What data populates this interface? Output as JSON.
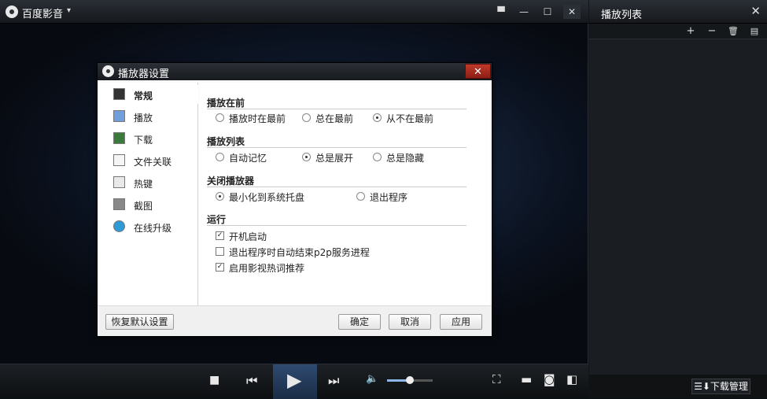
{
  "app": {
    "title": "百度影音",
    "title_arrow": "▾",
    "buttons": {
      "message": "▀",
      "minimize": "—",
      "maximize": "☐",
      "close": "✕"
    }
  },
  "playlist": {
    "title": "播放列表",
    "close": "✕",
    "tools": [
      "+",
      "−",
      "🗑",
      "▤"
    ],
    "download_manager": "☰⬇下载管理"
  },
  "controls": {
    "stop": "■",
    "prev": "⏮",
    "play": "▶",
    "next": "⏭",
    "volume": "🔈",
    "volume_level": 0.5,
    "fullscreen": "⛶",
    "open_folder": "▬",
    "screenshot": "◙",
    "panel": "◧"
  },
  "dialog": {
    "title": "播放器设置",
    "close": "✕",
    "nav": [
      {
        "label": "常规",
        "active": true
      },
      {
        "label": "播放",
        "active": false
      },
      {
        "label": "下载",
        "active": false
      },
      {
        "label": "文件关联",
        "active": false
      },
      {
        "label": "热键",
        "active": false
      },
      {
        "label": "截图",
        "active": false
      },
      {
        "label": "在线升级",
        "active": false
      }
    ],
    "sections": {
      "play_on_top": {
        "title": "播放在前",
        "options": [
          "播放时在最前",
          "总在最前",
          "从不在最前"
        ],
        "selected": 2
      },
      "playlist": {
        "title": "播放列表",
        "options": [
          "自动记忆",
          "总是展开",
          "总是隐藏"
        ],
        "selected": 1
      },
      "close_player": {
        "title": "关闭播放器",
        "options": [
          "最小化到系统托盘",
          "退出程序"
        ],
        "selected": 0
      },
      "run": {
        "title": "运行",
        "options": [
          {
            "label": "开机启动",
            "checked": true
          },
          {
            "label": "退出程序时自动结束p2p服务进程",
            "checked": false
          },
          {
            "label": "启用影视热词推荐",
            "checked": true
          }
        ]
      }
    },
    "buttons": {
      "restore_default": "恢复默认设置",
      "ok": "确定",
      "cancel": "取消",
      "apply": "应用"
    }
  }
}
